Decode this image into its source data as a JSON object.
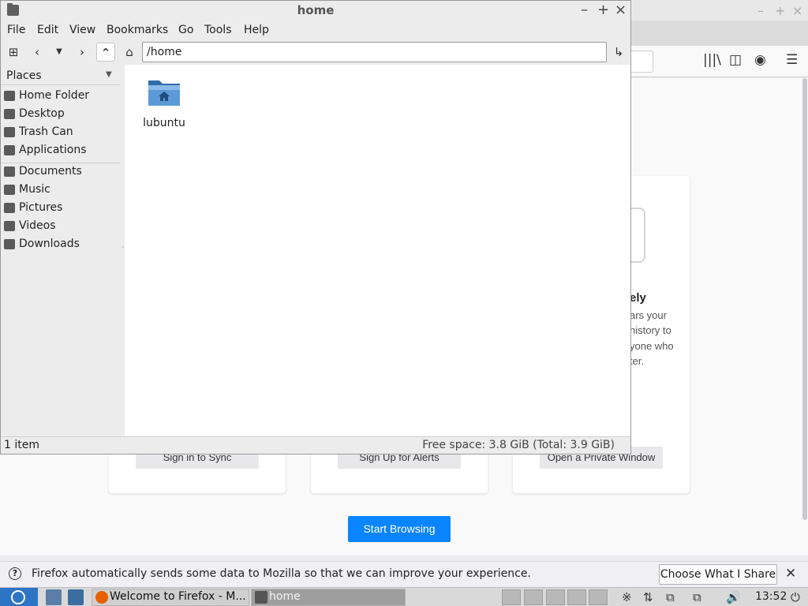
{
  "firefox": {
    "cards": [
      {
        "button": "Sign in to Sync"
      },
      {
        "button": "Sign Up for Alerts"
      },
      {
        "button": "Open a Private Window",
        "title_fragment": "ely",
        "lines": [
          "ars your",
          "nistory to",
          "yone who",
          "ter."
        ]
      }
    ],
    "start_button": "Start Browsing",
    "notification": {
      "text": "Firefox automatically sends some data to Mozilla so that we can improve your experience.",
      "button": "Choose What I Share"
    },
    "accent": "#0a84ff"
  },
  "filemanager": {
    "title": "home",
    "menu": [
      "File",
      "Edit",
      "View",
      "Bookmarks",
      "Go",
      "Tools",
      "Help"
    ],
    "path": "/home",
    "places_label": "Places",
    "places": [
      "Home Folder",
      "Desktop",
      "Trash Can",
      "Applications"
    ],
    "bookmarks": [
      "Documents",
      "Music",
      "Pictures",
      "Videos",
      "Downloads"
    ],
    "items": [
      {
        "name": "lubuntu",
        "icon": "home-folder-icon"
      }
    ],
    "status_left": "1 item",
    "status_right": "Free space: 3.8 GiB (Total: 3.9 GiB)"
  },
  "taskbar": {
    "tasks": [
      "Welcome to Firefox - M...",
      "home"
    ],
    "clock": "13:52"
  }
}
